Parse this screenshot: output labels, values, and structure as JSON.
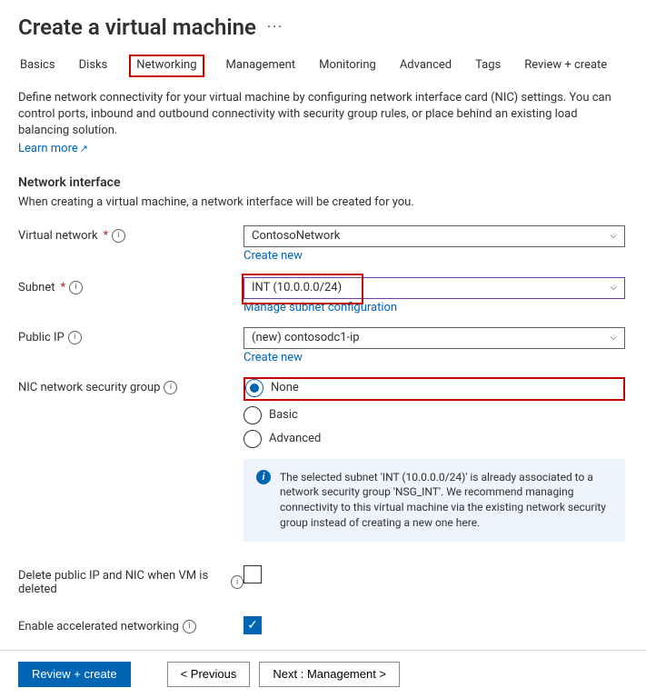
{
  "header": {
    "title": "Create a virtual machine",
    "more": "···"
  },
  "tabs": [
    "Basics",
    "Disks",
    "Networking",
    "Management",
    "Monitoring",
    "Advanced",
    "Tags",
    "Review + create"
  ],
  "active_tab_index": 2,
  "intro": {
    "text": "Define network connectivity for your virtual machine by configuring network interface card (NIC) settings. You can control ports, inbound and outbound connectivity with security group rules, or place behind an existing load balancing solution.",
    "learn_more": "Learn more"
  },
  "section": {
    "title": "Network interface",
    "sub": "When creating a virtual machine, a network interface will be created for you."
  },
  "fields": {
    "vnet": {
      "label": "Virtual network",
      "value": "ContosoNetwork",
      "link": "Create new"
    },
    "subnet": {
      "label": "Subnet",
      "value": "INT (10.0.0.0/24)",
      "link": "Manage subnet configuration"
    },
    "pip": {
      "label": "Public IP",
      "value": "(new) contosodc1-ip",
      "link": "Create new"
    },
    "nsg": {
      "label": "NIC network security group",
      "options": [
        "None",
        "Basic",
        "Advanced"
      ],
      "selected": 0
    },
    "info_msg": "The selected subnet 'INT (10.0.0.0/24)' is already associated to a network security group 'NSG_INT'. We recommend managing connectivity to this virtual machine via the existing network security group instead of creating a new one here.",
    "delete_pip": {
      "label": "Delete public IP and NIC when VM is deleted",
      "checked": false
    },
    "accel_net": {
      "label": "Enable accelerated networking",
      "checked": true
    }
  },
  "footer": {
    "review": "Review + create",
    "prev": "< Previous",
    "next": "Next : Management >"
  }
}
